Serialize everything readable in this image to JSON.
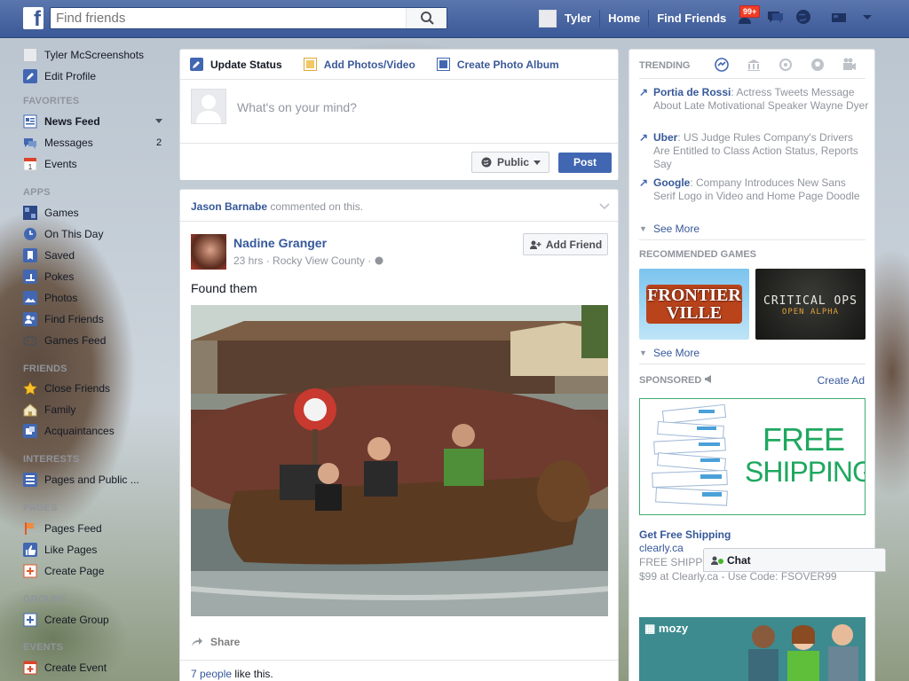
{
  "topbar": {
    "logo": "f",
    "search_placeholder": "Find friends",
    "user_name": "Tyler",
    "home": "Home",
    "find_friends": "Find Friends",
    "friend_request_count": "99+"
  },
  "sidebar": {
    "profile_name": "Tyler McScreenshots",
    "edit_profile": "Edit Profile",
    "favorites_header": "FAVORITES",
    "news_feed": "News Feed",
    "messages": "Messages",
    "messages_count": "2",
    "events": "Events",
    "apps_header": "APPS",
    "apps": [
      "Games",
      "On This Day",
      "Saved",
      "Pokes",
      "Photos",
      "Find Friends",
      "Games Feed"
    ],
    "friends_header": "FRIENDS",
    "friends": [
      "Close Friends",
      "Family",
      "Acquaintances"
    ],
    "interests_header": "INTERESTS",
    "interests": [
      "Pages and Public ..."
    ],
    "pages_header": "PAGES",
    "pages": [
      "Pages Feed",
      "Like Pages",
      "Create Page"
    ],
    "groups_header": "GROUPS",
    "groups": [
      "Create Group"
    ],
    "events_header": "EVENTS",
    "events_items": [
      "Create Event"
    ]
  },
  "composer": {
    "tab_status": "Update Status",
    "tab_photos": "Add Photos/Video",
    "tab_album": "Create Photo Album",
    "placeholder": "What's on your mind?",
    "privacy": "Public",
    "post_button": "Post"
  },
  "post": {
    "story_actor": "Jason Barnabe",
    "story_text": "commented on this.",
    "author": "Nadine Granger",
    "time": "23 hrs",
    "location": "Rocky View County",
    "add_friend": "Add Friend",
    "text": "Found them",
    "share": "Share",
    "likes_link": "7 people",
    "likes_text": "like this."
  },
  "right": {
    "trending_header": "TRENDING",
    "trending": [
      {
        "topic": "Portia de Rossi",
        "text": ": Actress Tweets Message About Late Motivational Speaker Wayne Dyer"
      },
      {
        "topic": "Uber",
        "text": ": US Judge Rules Company's Drivers Are Entitled to Class Action Status, Reports Say"
      },
      {
        "topic": "Google",
        "text": ": Company Introduces New Sans Serif Logo in Video and Home Page Doodle"
      }
    ],
    "see_more": "See More",
    "games_header": "RECOMMENDED GAMES",
    "game1_line1": "FRONTIER",
    "game1_line2": "VILLE",
    "game2_line1": "CRITICAL OPS",
    "game2_line2": "OPEN ALPHA",
    "sponsored_header": "SPONSORED",
    "create_ad": "Create Ad",
    "ad_headline_1": "FREE",
    "ad_headline_2": "SHIPPING",
    "ad_title": "Get Free Shipping",
    "ad_domain": "clearly.ca",
    "ad_body_1": "FREE SHIPP",
    "ad_body_2": "$99 at Clearly.ca - Use Code: FSOVER99",
    "ad2_brand": "mozy",
    "chat": "Chat"
  }
}
